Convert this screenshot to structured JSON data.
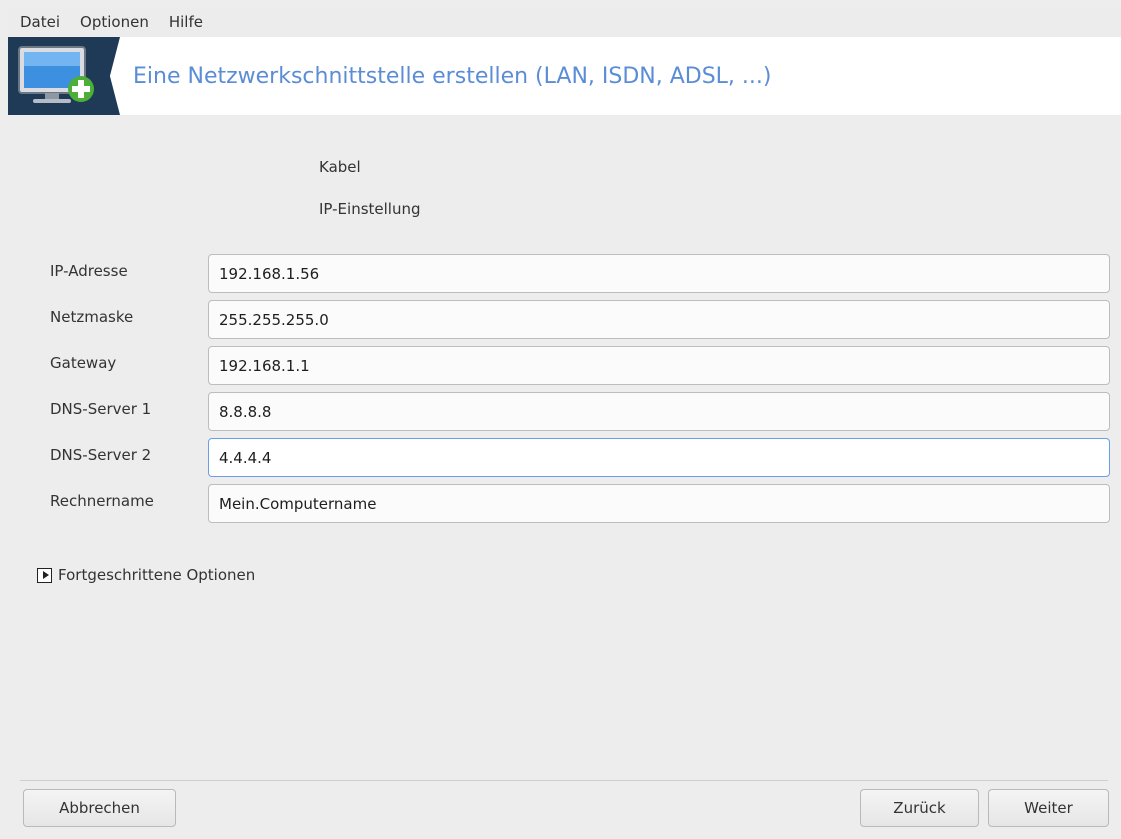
{
  "menubar": {
    "items": [
      "Datei",
      "Optionen",
      "Hilfe"
    ]
  },
  "banner": {
    "title": "Eine Netzwerkschnittstelle erstellen (LAN, ISDN, ADSL, ...)",
    "icon": "network-monitor-add-icon",
    "colors": {
      "title": "#5b8dd6",
      "icon_bg": "#1f3a57"
    }
  },
  "main": {
    "connection_type": "Kabel",
    "section_title": "IP-Einstellung",
    "fields": [
      {
        "label": "IP-Adresse",
        "value": "192.168.1.56"
      },
      {
        "label": "Netzmaske",
        "value": "255.255.255.0"
      },
      {
        "label": "Gateway",
        "value": "192.168.1.1"
      },
      {
        "label": "DNS-Server 1",
        "value": "8.8.8.8"
      },
      {
        "label": "DNS-Server 2",
        "value": "4.4.4.4"
      },
      {
        "label": "Rechnername",
        "value": "Mein.Computername"
      }
    ],
    "advanced_options": "Fortgeschrittene Optionen"
  },
  "footer": {
    "cancel": "Abbrechen",
    "back": "Zurück",
    "next": "Weiter"
  }
}
